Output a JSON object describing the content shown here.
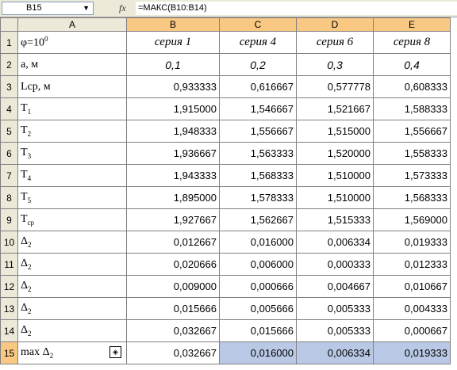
{
  "formula_bar": {
    "name_box": "B15",
    "fx_symbol": "fx",
    "formula": "=МАКС(B10:B14)"
  },
  "columns": [
    "A",
    "B",
    "C",
    "D",
    "E"
  ],
  "header_row": {
    "label_base": "φ=10",
    "label_sup": "0",
    "series": [
      "серия 1",
      "серия 4",
      "серия 6",
      "серия 8"
    ]
  },
  "param_row": {
    "label": "a, м",
    "values": [
      "0,1",
      "0,2",
      "0,3",
      "0,4"
    ]
  },
  "rows": [
    {
      "num": "3",
      "base": "Lср, м",
      "sub": "",
      "values": [
        "0,933333",
        "0,616667",
        "0,577778",
        "0,608333"
      ]
    },
    {
      "num": "4",
      "base": "T",
      "sub": "1",
      "values": [
        "1,915000",
        "1,546667",
        "1,521667",
        "1,588333"
      ]
    },
    {
      "num": "5",
      "base": "T",
      "sub": "2",
      "values": [
        "1,948333",
        "1,556667",
        "1,515000",
        "1,556667"
      ]
    },
    {
      "num": "6",
      "base": "T",
      "sub": "3",
      "values": [
        "1,936667",
        "1,563333",
        "1,520000",
        "1,558333"
      ]
    },
    {
      "num": "7",
      "base": "T",
      "sub": "4",
      "values": [
        "1,943333",
        "1,568333",
        "1,510000",
        "1,573333"
      ]
    },
    {
      "num": "8",
      "base": "T",
      "sub": "5",
      "values": [
        "1,895000",
        "1,578333",
        "1,510000",
        "1,568333"
      ]
    },
    {
      "num": "9",
      "base": "T",
      "sub": "ср",
      "values": [
        "1,927667",
        "1,562667",
        "1,515333",
        "1,569000"
      ]
    },
    {
      "num": "10",
      "base": "Δ",
      "sub": "2",
      "values": [
        "0,012667",
        "0,016000",
        "0,006334",
        "0,019333"
      ]
    },
    {
      "num": "11",
      "base": "Δ",
      "sub": "2",
      "values": [
        "0,020666",
        "0,006000",
        "0,000333",
        "0,012333"
      ]
    },
    {
      "num": "12",
      "base": "Δ",
      "sub": "2",
      "values": [
        "0,009000",
        "0,000666",
        "0,004667",
        "0,010667"
      ]
    },
    {
      "num": "13",
      "base": "Δ",
      "sub": "2",
      "values": [
        "0,015666",
        "0,005666",
        "0,005333",
        "0,004333"
      ]
    },
    {
      "num": "14",
      "base": "Δ",
      "sub": "2",
      "values": [
        "0,032667",
        "0,015666",
        "0,005333",
        "0,000667"
      ]
    },
    {
      "num": "15",
      "base": "max Δ",
      "sub": "2",
      "values": [
        "0,032667",
        "0,016000",
        "0,006334",
        "0,019333"
      ]
    }
  ],
  "active_row_index": 12,
  "highlight_columns": [
    1,
    2,
    3
  ],
  "smart_tag_icon": "error-check-icon",
  "colors": {
    "header_bg": "#ece9d8",
    "selected_header": "#f9c883",
    "highlight_cells": "#b9c9e5",
    "gridlines": "#808080"
  }
}
